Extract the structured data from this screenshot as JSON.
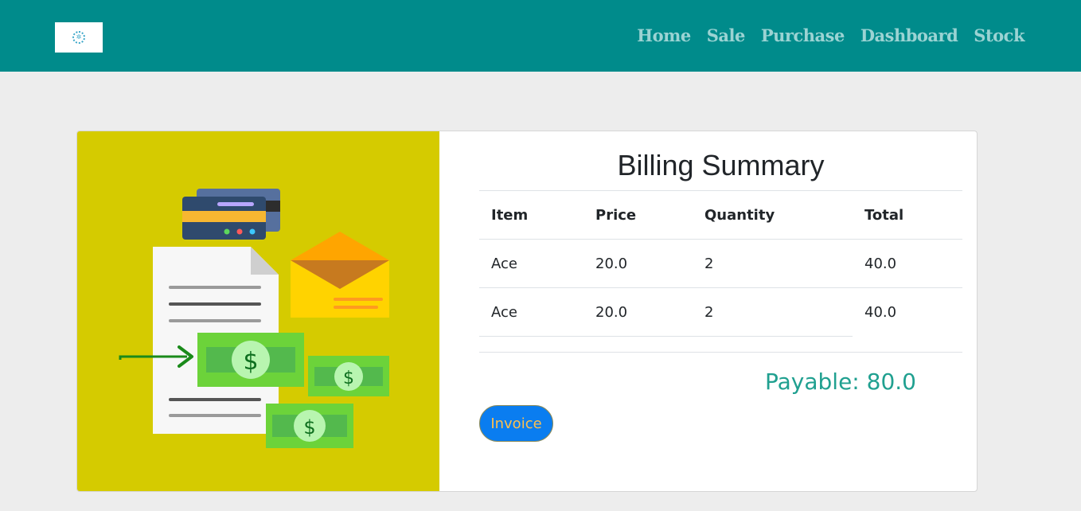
{
  "nav": {
    "links": [
      "Home",
      "Sale",
      "Purchase",
      "Dashboard",
      "Stock"
    ]
  },
  "billing": {
    "title": "Billing Summary",
    "columns": [
      "Item",
      "Price",
      "Quantity",
      "Total"
    ],
    "rows": [
      [
        "Ace",
        "20.0",
        "2",
        "40.0"
      ],
      [
        "Ace",
        "20.0",
        "2",
        "40.0"
      ]
    ],
    "payable": "Payable: 80.0",
    "invoice_label": "Invoice"
  },
  "illustration": {
    "currency_symbol": "$"
  },
  "colors": {
    "navbar": "#008b8b",
    "hero_background": "#d5cb00",
    "payable_text": "#20a090",
    "invoice_button": "#0a7df0"
  }
}
